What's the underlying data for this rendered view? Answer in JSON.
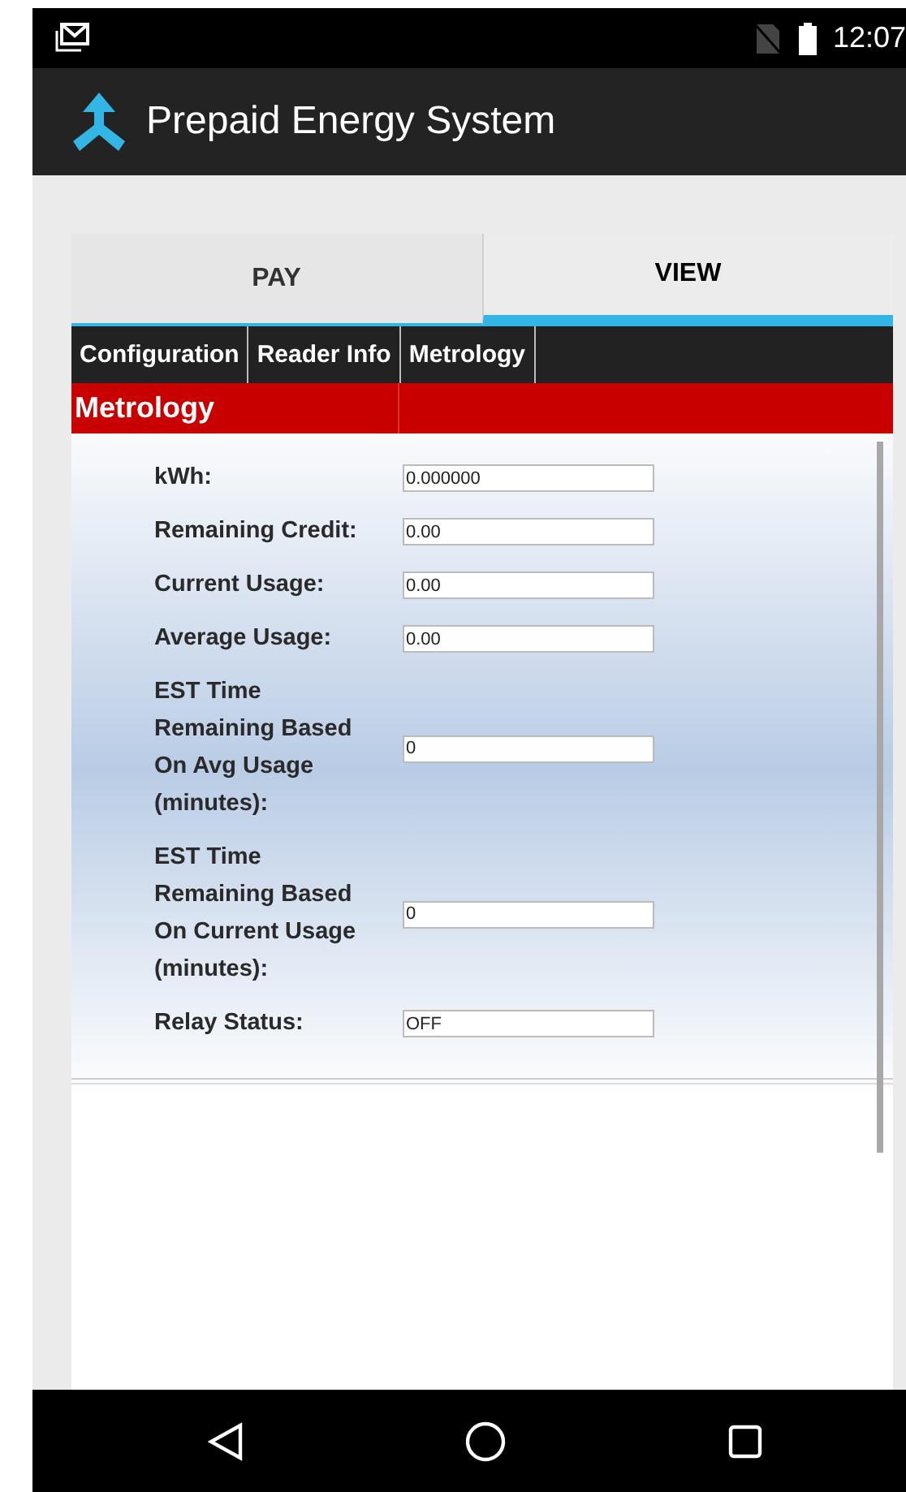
{
  "status_bar": {
    "time": "12:07"
  },
  "app_bar": {
    "title": "Prepaid Energy System"
  },
  "tabs": [
    {
      "label": "PAY",
      "selected": false
    },
    {
      "label": "VIEW",
      "selected": true
    }
  ],
  "sub_tabs": [
    "Configuration",
    "Reader Info",
    "Metrology"
  ],
  "section": {
    "title": "Metrology"
  },
  "fields": [
    {
      "label": "kWh:",
      "value": "0.000000"
    },
    {
      "label": "Remaining Credit:",
      "value": "0.00"
    },
    {
      "label": "Current Usage:",
      "value": "0.00"
    },
    {
      "label": "Average Usage:",
      "value": "0.00"
    },
    {
      "label": "EST Time Remaining Based On Avg Usage (minutes):",
      "value": "0"
    },
    {
      "label": "EST Time Remaining Based On Current Usage (minutes):",
      "value": "0"
    },
    {
      "label": "Relay Status:",
      "value": "OFF"
    }
  ]
}
